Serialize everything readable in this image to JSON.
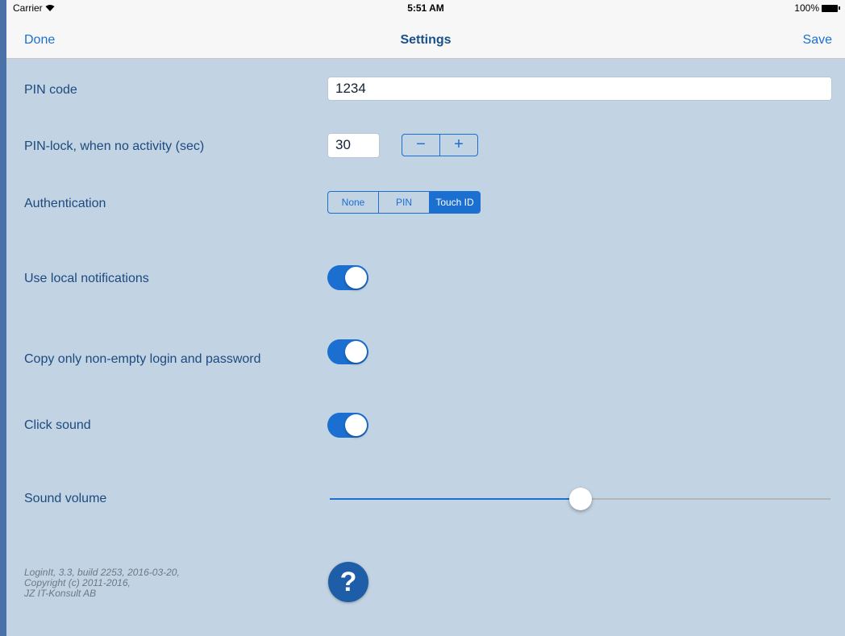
{
  "status_bar": {
    "carrier": "Carrier",
    "wifi_icon": "wifi-icon",
    "time": "5:51 AM",
    "battery": "100%"
  },
  "nav": {
    "left_button": "Done",
    "title": "Settings",
    "right_button": "Save"
  },
  "settings": {
    "pin_code": {
      "label": "PIN code",
      "value": "1234"
    },
    "pin_lock": {
      "label": "PIN-lock, when no activity (sec)",
      "value": "30",
      "minus": "−",
      "plus": "+"
    },
    "authentication": {
      "label": "Authentication",
      "options": [
        "None",
        "PIN",
        "Touch ID"
      ],
      "selected": "Touch ID"
    },
    "local_notifications": {
      "label": "Use local notifications",
      "on": true
    },
    "copy_nonempty": {
      "label": "Copy only non-empty login and password",
      "on": true
    },
    "click_sound": {
      "label": "Click sound",
      "on": true
    },
    "sound_volume": {
      "label": "Sound volume",
      "value": 0.5
    }
  },
  "footer": {
    "line1": "LoginIt, 3.3, build 2253, 2016-03-20,",
    "line2": "Copyright (c) 2011-2016,",
    "line3": "JZ IT-Konsult AB"
  },
  "help_button": {
    "icon": "question-icon",
    "glyph": "?"
  },
  "colors": {
    "accent": "#1a6fd1",
    "background": "#c2d3e3",
    "label": "#1d4a7e"
  }
}
